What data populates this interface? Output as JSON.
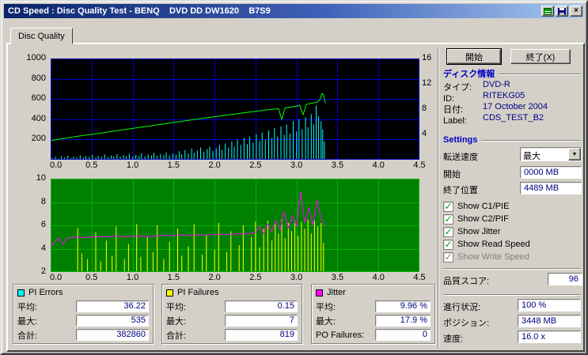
{
  "window": {
    "title": "CD Speed : Disc Quality Test - BENQ    DVD DD DW1620    B7S9"
  },
  "icons": {
    "graph_icon": "green-graph",
    "save_icon": "floppy-disk",
    "close_icon": "×",
    "dropdown_arrow": "▼",
    "checkmark": "✓"
  },
  "colors": {
    "chrome": "#D4D0C8",
    "titlebar_start": "#0A246A",
    "titlebar_end": "#A6CAF0",
    "value_text": "#000080",
    "header_text": "#0000C8",
    "check_green": "#00A000",
    "pi_errors": "#00FFFF",
    "pi_failures": "#FFFF00",
    "jitter": "#FF00FF",
    "read_speed": "#00FF00"
  },
  "tab": {
    "label": "Disc Quality"
  },
  "buttons": {
    "start": "開始",
    "exit": "終了(X)"
  },
  "disc_info": {
    "header": "ディスク情報",
    "rows": [
      {
        "label": "タイプ:",
        "value": "DVD-R"
      },
      {
        "label": "ID:",
        "value": "RITEKG05"
      },
      {
        "label": "日付:",
        "value": "17 October 2004"
      },
      {
        "label": "Label:",
        "value": "CDS_TEST_B2"
      }
    ]
  },
  "settings": {
    "header": "Settings",
    "transfer_speed_label": "転送速度",
    "transfer_speed_value": "最大",
    "start_label": "開始",
    "start_value": "0000 MB",
    "end_label": "終了位置",
    "end_value": "4489 MB",
    "checkboxes": [
      {
        "label": "Show C1/PIE",
        "checked": true,
        "enabled": true
      },
      {
        "label": "Show C2/PIF",
        "checked": true,
        "enabled": true
      },
      {
        "label": "Show Jitter",
        "checked": true,
        "enabled": true
      },
      {
        "label": "Show Read Speed",
        "checked": true,
        "enabled": true
      },
      {
        "label": "Show Write Speed",
        "checked": true,
        "enabled": false
      }
    ],
    "quality_score_label": "品質スコア:",
    "quality_score_value": "96"
  },
  "status": {
    "rows": [
      {
        "label": "進行状況:",
        "value": "100 %"
      },
      {
        "label": "ポジション:",
        "value": "3448 MB"
      },
      {
        "label": "速度:",
        "value": "16.0 x"
      }
    ]
  },
  "stats": [
    {
      "title": "PI Errors",
      "swatch": "#00FFFF",
      "rows": [
        {
          "label": "平均:",
          "value": "36.22"
        },
        {
          "label": "最大:",
          "value": "535"
        },
        {
          "label": "合計:",
          "value": "382860"
        }
      ]
    },
    {
      "title": "PI Failures",
      "swatch": "#FFFF00",
      "rows": [
        {
          "label": "平均:",
          "value": "0.15"
        },
        {
          "label": "最大:",
          "value": "7"
        },
        {
          "label": "合計:",
          "value": "819"
        }
      ]
    },
    {
      "title": "Jitter",
      "swatch": "#FF00FF",
      "rows": [
        {
          "label": "平均:",
          "value": "9.96 %"
        },
        {
          "label": "最大:",
          "value": "17.9 %"
        },
        {
          "label": "PO Failures:",
          "value": "0"
        }
      ]
    }
  ],
  "chart_data": [
    {
      "type": "line",
      "title": "PI Errors / Read Speed",
      "bg": "#000000",
      "grid": "#0000CC",
      "xlim": [
        0,
        4.5
      ],
      "x_ticks": [
        0,
        0.5,
        1,
        1.5,
        2,
        2.5,
        3,
        3.5,
        4,
        4.5
      ],
      "left_lim": [
        0,
        1000
      ],
      "left_ticks": [
        200,
        400,
        600,
        800,
        1000
      ],
      "right_lim": [
        0,
        16
      ],
      "right_ticks": [
        4,
        8,
        12,
        16
      ],
      "legend": "off",
      "series": [
        {
          "name": "PI Errors",
          "color": "#00FFFF",
          "style": "spikes",
          "points": [
            [
              0.02,
              18
            ],
            [
              0.06,
              30
            ],
            [
              0.1,
              12
            ],
            [
              0.13,
              35
            ],
            [
              0.17,
              22
            ],
            [
              0.21,
              40
            ],
            [
              0.25,
              15
            ],
            [
              0.28,
              32
            ],
            [
              0.32,
              24
            ],
            [
              0.36,
              45
            ],
            [
              0.4,
              20
            ],
            [
              0.43,
              35
            ],
            [
              0.47,
              28
            ],
            [
              0.51,
              48
            ],
            [
              0.55,
              22
            ],
            [
              0.58,
              38
            ],
            [
              0.62,
              30
            ],
            [
              0.66,
              52
            ],
            [
              0.7,
              25
            ],
            [
              0.74,
              42
            ],
            [
              0.77,
              33
            ],
            [
              0.81,
              55
            ],
            [
              0.85,
              28
            ],
            [
              0.89,
              46
            ],
            [
              0.92,
              35
            ],
            [
              0.96,
              58
            ],
            [
              1.0,
              30
            ],
            [
              1.04,
              48
            ],
            [
              1.08,
              38
            ],
            [
              1.11,
              62
            ],
            [
              1.15,
              33
            ],
            [
              1.19,
              52
            ],
            [
              1.23,
              42
            ],
            [
              1.26,
              68
            ],
            [
              1.3,
              38
            ],
            [
              1.34,
              56
            ],
            [
              1.38,
              45
            ],
            [
              1.41,
              72
            ],
            [
              1.45,
              40
            ],
            [
              1.49,
              60
            ],
            [
              1.53,
              50
            ],
            [
              1.57,
              85
            ],
            [
              1.6,
              55
            ],
            [
              1.64,
              95
            ],
            [
              1.68,
              62
            ],
            [
              1.72,
              110
            ],
            [
              1.75,
              70
            ],
            [
              1.79,
              90
            ],
            [
              1.83,
              120
            ],
            [
              1.87,
              75
            ],
            [
              1.91,
              105
            ],
            [
              1.94,
              130
            ],
            [
              1.98,
              85
            ],
            [
              2.02,
              115
            ],
            [
              2.06,
              145
            ],
            [
              2.09,
              95
            ],
            [
              2.13,
              160
            ],
            [
              2.17,
              120
            ],
            [
              2.21,
              180
            ],
            [
              2.24,
              130
            ],
            [
              2.28,
              200
            ],
            [
              2.32,
              145
            ],
            [
              2.36,
              215
            ],
            [
              2.4,
              155
            ],
            [
              2.43,
              230
            ],
            [
              2.47,
              170
            ],
            [
              2.51,
              250
            ],
            [
              2.55,
              185
            ],
            [
              2.58,
              270
            ],
            [
              2.62,
              200
            ],
            [
              2.66,
              290
            ],
            [
              2.7,
              215
            ],
            [
              2.73,
              310
            ],
            [
              2.77,
              230
            ],
            [
              2.81,
              330
            ],
            [
              2.85,
              245
            ],
            [
              2.88,
              350
            ],
            [
              2.92,
              260
            ],
            [
              2.96,
              380
            ],
            [
              3.0,
              280
            ],
            [
              3.03,
              400
            ],
            [
              3.07,
              300
            ],
            [
              3.11,
              420
            ],
            [
              3.14,
              320
            ],
            [
              3.18,
              450
            ],
            [
              3.21,
              350
            ],
            [
              3.24,
              535
            ],
            [
              3.27,
              430
            ],
            [
              3.3,
              380
            ],
            [
              3.32,
              300
            ],
            [
              3.34,
              180
            ]
          ]
        },
        {
          "name": "Read Speed",
          "color": "#00FF00",
          "style": "line",
          "points": [
            [
              0,
              190
            ],
            [
              0.3,
              228
            ],
            [
              0.6,
              262
            ],
            [
              0.9,
              298
            ],
            [
              1.2,
              332
            ],
            [
              1.5,
              368
            ],
            [
              1.8,
              402
            ],
            [
              2.1,
              436
            ],
            [
              2.4,
              468
            ],
            [
              2.6,
              488
            ],
            [
              2.78,
              505
            ],
            [
              2.82,
              400
            ],
            [
              2.86,
              512
            ],
            [
              3.0,
              528
            ],
            [
              3.04,
              538
            ],
            [
              3.08,
              445
            ],
            [
              3.12,
              548
            ],
            [
              3.2,
              560
            ],
            [
              3.26,
              572
            ],
            [
              3.29,
              600
            ],
            [
              3.31,
              655
            ],
            [
              3.33,
              640
            ],
            [
              3.35,
              560
            ]
          ]
        }
      ]
    },
    {
      "type": "line",
      "title": "PI Failures / Jitter",
      "bg": "#008000",
      "grid": "#00B400",
      "xlim": [
        0,
        4.5
      ],
      "x_ticks": [
        0,
        0.5,
        1,
        1.5,
        2,
        2.5,
        3,
        3.5,
        4,
        4.5
      ],
      "left_lim": [
        2,
        10
      ],
      "left_ticks": [
        2,
        4,
        6,
        8,
        10
      ],
      "legend": "off",
      "series": [
        {
          "name": "PI Failures",
          "color": "#FFFF00",
          "style": "spikes",
          "baseline": 2,
          "points": [
            [
              0.33,
              5.8
            ],
            [
              0.38,
              3.6
            ],
            [
              0.45,
              3.1
            ],
            [
              0.55,
              5.4
            ],
            [
              0.61,
              2.9
            ],
            [
              0.68,
              4.7
            ],
            [
              0.75,
              3.4
            ],
            [
              0.8,
              5.9
            ],
            [
              0.9,
              3.1
            ],
            [
              0.95,
              4.4
            ],
            [
              1.05,
              6.1
            ],
            [
              1.1,
              3.3
            ],
            [
              1.18,
              5.0
            ],
            [
              1.25,
              3.7
            ],
            [
              1.3,
              6.0
            ],
            [
              1.38,
              3.1
            ],
            [
              1.45,
              4.6
            ],
            [
              1.55,
              5.7
            ],
            [
              1.6,
              3.4
            ],
            [
              1.68,
              4.2
            ],
            [
              1.75,
              6.1
            ],
            [
              1.85,
              3.5
            ],
            [
              1.9,
              5.2
            ],
            [
              2.0,
              3.9
            ],
            [
              2.05,
              6.2
            ],
            [
              2.15,
              3.7
            ],
            [
              2.2,
              5.5
            ],
            [
              2.3,
              4.3
            ],
            [
              2.35,
              6.0
            ],
            [
              2.45,
              5.0
            ],
            [
              2.5,
              6.3
            ],
            [
              2.55,
              4.1
            ],
            [
              2.6,
              5.7
            ],
            [
              2.65,
              6.4
            ],
            [
              2.7,
              4.7
            ],
            [
              2.74,
              6.1
            ],
            [
              2.78,
              5.3
            ],
            [
              2.82,
              6.5
            ],
            [
              2.86,
              4.9
            ],
            [
              2.9,
              6.2
            ],
            [
              2.94,
              5.5
            ],
            [
              2.98,
              6.4
            ],
            [
              3.02,
              5.1
            ],
            [
              3.06,
              6.3
            ],
            [
              3.1,
              5.7
            ],
            [
              3.14,
              6.5
            ],
            [
              3.18,
              5.3
            ],
            [
              3.22,
              6.4
            ],
            [
              3.26,
              5.9
            ],
            [
              3.3,
              6.2
            ],
            [
              3.33,
              4.5
            ]
          ]
        },
        {
          "name": "Jitter",
          "color": "#FF00FF",
          "style": "line",
          "points": [
            [
              0,
              4.1
            ],
            [
              0.05,
              4.6
            ],
            [
              0.1,
              4.9
            ],
            [
              0.15,
              4.4
            ],
            [
              0.2,
              4.9
            ],
            [
              0.3,
              5.0
            ],
            [
              0.4,
              4.95
            ],
            [
              0.5,
              5.0
            ],
            [
              0.6,
              5.05
            ],
            [
              0.7,
              5.0
            ],
            [
              0.8,
              5.1
            ],
            [
              0.9,
              5.0
            ],
            [
              1.0,
              5.05
            ],
            [
              1.1,
              5.1
            ],
            [
              1.2,
              5.0
            ],
            [
              1.3,
              5.1
            ],
            [
              1.4,
              5.15
            ],
            [
              1.5,
              5.1
            ],
            [
              1.6,
              5.2
            ],
            [
              1.7,
              5.1
            ],
            [
              1.8,
              5.2
            ],
            [
              1.9,
              5.15
            ],
            [
              2.0,
              5.2
            ],
            [
              2.1,
              5.25
            ],
            [
              2.2,
              5.2
            ],
            [
              2.3,
              5.3
            ],
            [
              2.4,
              5.25
            ],
            [
              2.5,
              5.4
            ],
            [
              2.55,
              5.9
            ],
            [
              2.6,
              5.3
            ],
            [
              2.65,
              6.1
            ],
            [
              2.7,
              5.5
            ],
            [
              2.75,
              6.4
            ],
            [
              2.8,
              5.6
            ],
            [
              2.85,
              7.2
            ],
            [
              2.9,
              5.8
            ],
            [
              2.95,
              6.8
            ],
            [
              3.0,
              5.9
            ],
            [
              3.05,
              8.9
            ],
            [
              3.1,
              6.2
            ],
            [
              3.15,
              7.5
            ],
            [
              3.2,
              6.0
            ],
            [
              3.25,
              8.2
            ],
            [
              3.3,
              6.5
            ],
            [
              3.35,
              6.0
            ]
          ]
        }
      ]
    }
  ]
}
